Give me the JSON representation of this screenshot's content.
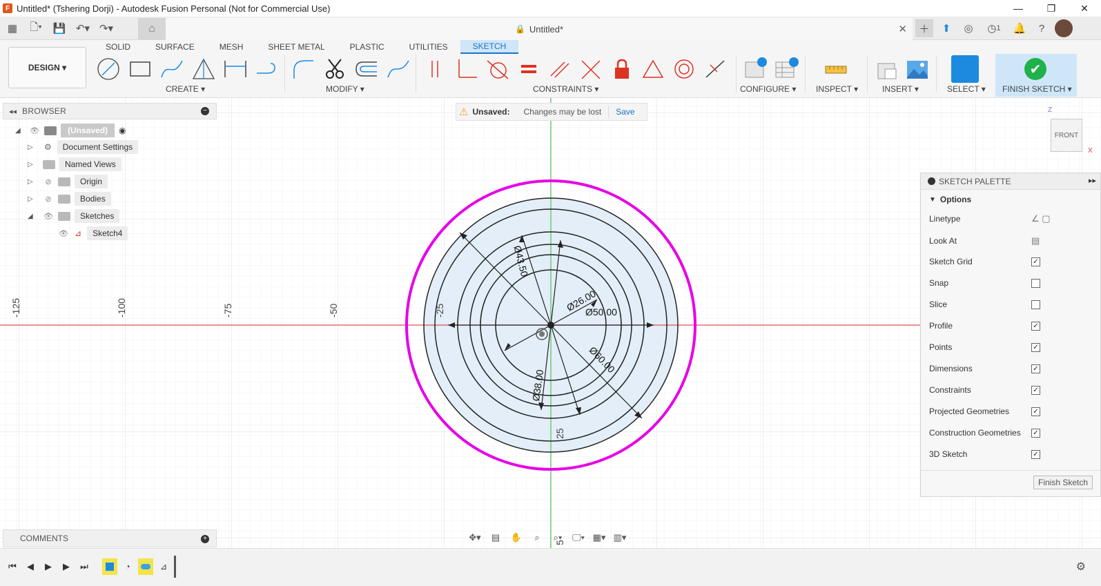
{
  "window": {
    "title": "Untitled* (Tshering Dorji) - Autodesk Fusion Personal (Not for Commercial Use)",
    "minimize": "—",
    "maximize": "❐",
    "close": "✕"
  },
  "doc_tab": {
    "name": "Untitled*",
    "close": "✕"
  },
  "notifications_count": "1",
  "toolbar": {
    "design_label": "DESIGN ▾",
    "tabs": [
      "SOLID",
      "SURFACE",
      "MESH",
      "SHEET METAL",
      "PLASTIC",
      "UTILITIES",
      "SKETCH"
    ],
    "active_tab": "SKETCH",
    "groups": {
      "create": "CREATE ▾",
      "modify": "MODIFY ▾",
      "constraints": "CONSTRAINTS ▾",
      "configure": "CONFIGURE ▾",
      "inspect": "INSPECT ▾",
      "insert": "INSERT ▾",
      "select": "SELECT ▾",
      "finish": "FINISH SKETCH ▾"
    }
  },
  "browser": {
    "title": "BROWSER",
    "items": [
      {
        "label": "(Unsaved)"
      },
      {
        "label": "Document Settings"
      },
      {
        "label": "Named Views"
      },
      {
        "label": "Origin"
      },
      {
        "label": "Bodies"
      },
      {
        "label": "Sketches"
      },
      {
        "label": "Sketch4"
      }
    ]
  },
  "notice": {
    "title": "Unsaved:",
    "message": "Changes may be lost",
    "action": "Save"
  },
  "viewcube": {
    "face": "FRONT",
    "z": "Z",
    "x": "X"
  },
  "ruler": {
    "labels": [
      "-125",
      "-100",
      "-75",
      "-50",
      "-25",
      "25",
      "5"
    ]
  },
  "dimensions": {
    "d1": "Ø43.50",
    "d2": "Ø26.00",
    "d3": "Ø50.00",
    "d4": "Ø60.00",
    "d5": "Ø38.00"
  },
  "palette": {
    "title": "SKETCH PALETTE",
    "section": "Options",
    "rows": [
      {
        "label": "Linetype",
        "kind": "icon"
      },
      {
        "label": "Look At",
        "kind": "icon"
      },
      {
        "label": "Sketch Grid",
        "checked": true
      },
      {
        "label": "Snap",
        "checked": false
      },
      {
        "label": "Slice",
        "checked": false
      },
      {
        "label": "Profile",
        "checked": true
      },
      {
        "label": "Points",
        "checked": true
      },
      {
        "label": "Dimensions",
        "checked": true
      },
      {
        "label": "Constraints",
        "checked": true
      },
      {
        "label": "Projected Geometries",
        "checked": true
      },
      {
        "label": "Construction Geometries",
        "checked": true
      },
      {
        "label": "3D Sketch",
        "checked": true
      }
    ],
    "finish_button": "Finish Sketch"
  },
  "comments": {
    "title": "COMMENTS"
  },
  "colors": {
    "accent": "#1a73c8",
    "sketch_circle": "#e600e6",
    "x_axis": "#e05050",
    "y_axis": "#55c055",
    "profile_fill": "#e3eef8",
    "finish_green": "#1fb24a"
  }
}
